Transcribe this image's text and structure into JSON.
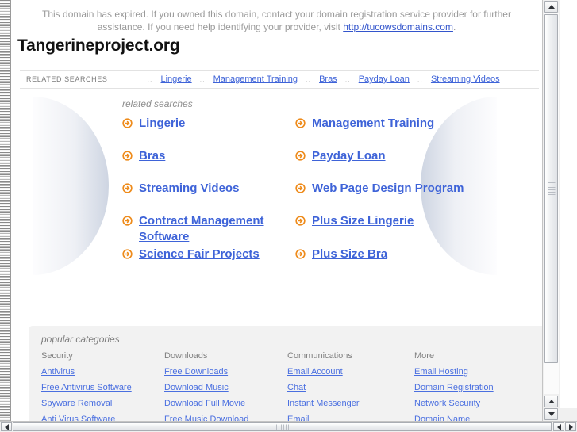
{
  "notice": {
    "line1": "This domain has expired. If you owned this domain, contact your domain registration service provider for further",
    "line2_pre": "assistance. If you need help identifying your provider, visit ",
    "link_text": "http://tucowsdomains.com",
    "line2_post": "."
  },
  "brand": {
    "title": "Tangerineproject.org"
  },
  "navbar": {
    "label": "RELATED SEARCHES",
    "separator": "::",
    "links": [
      "Lingerie",
      "Management Training",
      "Bras",
      "Payday Loan",
      "Streaming Videos"
    ]
  },
  "hero": {
    "title": "related searches",
    "links": [
      "Lingerie",
      "Management Training",
      "Bras",
      "Payday Loan",
      "Streaming Videos",
      "Web Page Design Program",
      "Contract Management Software",
      "Plus Size Lingerie",
      "Science Fair Projects",
      "Plus Size Bra"
    ]
  },
  "footer": {
    "title": "popular categories",
    "columns": [
      {
        "heading": "Security",
        "links": [
          "Antivirus",
          "Free Antivirus Software",
          "Spyware Removal",
          "Anti Virus Software"
        ]
      },
      {
        "heading": "Downloads",
        "links": [
          "Free Downloads",
          "Download Music",
          "Download Full Movie",
          "Free Music Download"
        ]
      },
      {
        "heading": "Communications",
        "links": [
          "Email Account",
          "Chat",
          "Instant Messenger",
          "Email"
        ]
      },
      {
        "heading": "More",
        "links": [
          "Email Hosting",
          "Domain Registration",
          "Network Security",
          "Domain Name"
        ]
      }
    ]
  },
  "colors": {
    "link": "#3e63d8",
    "footer_link": "#4a6fe0",
    "arrow_orange": "#ee8b1b",
    "muted_text": "#9a9a9a",
    "panel_bg": "#f2f2f2"
  }
}
